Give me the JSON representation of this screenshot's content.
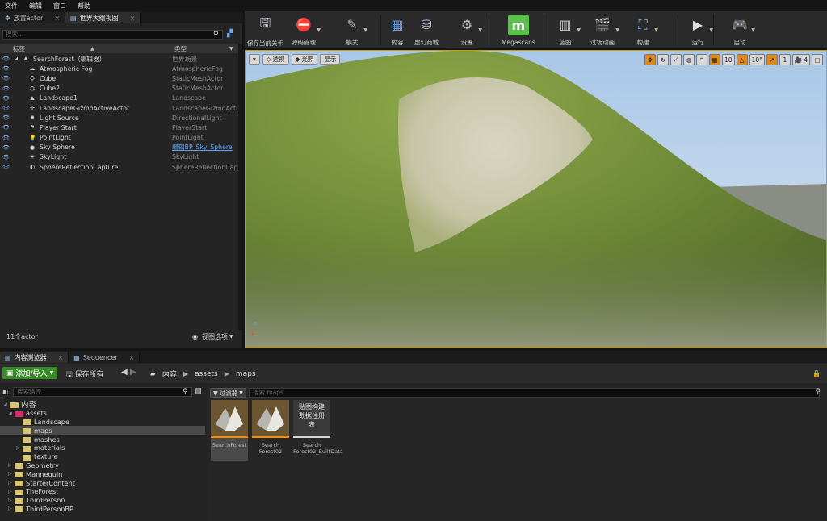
{
  "menubar": [
    "文件",
    "编辑",
    "窗口",
    "帮助"
  ],
  "left_tabs": [
    {
      "label": "放置actor",
      "active": false
    },
    {
      "label": "世界大纲视图",
      "active": true
    }
  ],
  "outliner": {
    "search_placeholder": "搜索...",
    "col_label": "标签",
    "col_type": "类型",
    "rows": [
      {
        "name": "SearchForest（编辑器）",
        "type": "世界场景",
        "icon": "world-icon",
        "indent": 0
      },
      {
        "name": "Atmospheric Fog",
        "type": "AtmosphericFog",
        "icon": "fog-icon",
        "indent": 1
      },
      {
        "name": "Cube",
        "type": "StaticMeshActor",
        "icon": "cube-icon",
        "indent": 1
      },
      {
        "name": "Cube2",
        "type": "StaticMeshActor",
        "icon": "cube-icon",
        "indent": 1
      },
      {
        "name": "Landscape1",
        "type": "Landscape",
        "icon": "landscape-icon",
        "indent": 1
      },
      {
        "name": "LandscapeGizmoActiveActor",
        "type": "LandscapeGizmoActive",
        "icon": "gizmo-icon",
        "indent": 1
      },
      {
        "name": "Light Source",
        "type": "DirectionalLight",
        "icon": "directional-light-icon",
        "indent": 1
      },
      {
        "name": "Player Start",
        "type": "PlayerStart",
        "icon": "player-start-icon",
        "indent": 1
      },
      {
        "name": "PointLight",
        "type": "PointLight",
        "icon": "point-light-icon",
        "indent": 1
      },
      {
        "name": "Sky Sphere",
        "type": "编辑BP_Sky_Sphere",
        "icon": "sphere-icon",
        "indent": 1,
        "link": true
      },
      {
        "name": "SkyLight",
        "type": "SkyLight",
        "icon": "sky-light-icon",
        "indent": 1
      },
      {
        "name": "SphereReflectionCapture",
        "type": "SphereReflectionCapture",
        "icon": "reflection-icon",
        "indent": 1
      }
    ],
    "actor_count": "11个actor",
    "view_options": "视图选项"
  },
  "toolbar": [
    {
      "label": "保存当前关卡",
      "icon": "save-icon",
      "color": "#cfd6e0"
    },
    {
      "label": "源码管理",
      "icon": "source-control-icon",
      "color": "#b8c0cc"
    },
    {
      "label": "模式",
      "icon": "modes-icon",
      "color": "#c0c0c0"
    },
    {
      "label": "内容",
      "icon": "content-icon",
      "color": "#6aa0e0"
    },
    {
      "label": "虚幻商城",
      "icon": "marketplace-icon",
      "color": "#c0d0f0"
    },
    {
      "label": "设置",
      "icon": "settings-icon",
      "color": "#c0c0c0"
    },
    {
      "label": "Megascans",
      "icon": "megascans-icon",
      "color": "#5ac24a"
    },
    {
      "label": "蓝图",
      "icon": "blueprint-icon",
      "color": "#c8c8c8"
    },
    {
      "label": "过场动画",
      "icon": "cinematics-icon",
      "color": "#c8c8c8"
    },
    {
      "label": "构建",
      "icon": "build-icon",
      "color": "#7aa8e8"
    },
    {
      "label": "运行",
      "icon": "play-icon",
      "color": "#e0e0e0"
    },
    {
      "label": "启动",
      "icon": "launch-icon",
      "color": "#c8c8c8"
    }
  ],
  "viewport": {
    "perspective": "透视",
    "lit": "光照",
    "show": "显示",
    "grid_snap": "10",
    "rot_snap": "10°",
    "scale_snap": "1",
    "camera_speed": "4"
  },
  "bottom_tabs": [
    {
      "label": "内容浏览器",
      "active": true
    },
    {
      "label": "Sequencer",
      "active": false
    }
  ],
  "content_browser": {
    "add_import": "添加/导入",
    "save_all": "保存所有",
    "breadcrumbs": [
      "内容",
      "assets",
      "maps"
    ],
    "tree_search_placeholder": "搜索路径",
    "filter_label": "过滤器",
    "asset_search_placeholder": "搜索 maps",
    "tree": [
      {
        "label": "内容",
        "indent": 0,
        "expanded": true,
        "color": "#d8c478"
      },
      {
        "label": "assets",
        "indent": 1,
        "expanded": true,
        "color": "#d0306a",
        "selected": true
      },
      {
        "label": "Landscape",
        "indent": 2,
        "color": "#d8c478"
      },
      {
        "label": "maps",
        "indent": 2,
        "color": "#d8c478",
        "selected": true
      },
      {
        "label": "mashes",
        "indent": 2,
        "color": "#d8c478"
      },
      {
        "label": "materials",
        "indent": 2,
        "collapsed": true,
        "color": "#d8c478"
      },
      {
        "label": "texture",
        "indent": 2,
        "color": "#d8c478"
      },
      {
        "label": "Geometry",
        "indent": 1,
        "collapsed": true,
        "color": "#d8c478"
      },
      {
        "label": "Mannequin",
        "indent": 1,
        "collapsed": true,
        "color": "#d8c478"
      },
      {
        "label": "StarterContent",
        "indent": 1,
        "collapsed": true,
        "color": "#d8c478"
      },
      {
        "label": "TheForest",
        "indent": 1,
        "collapsed": true,
        "color": "#d8c478"
      },
      {
        "label": "ThirdPerson",
        "indent": 1,
        "collapsed": true,
        "color": "#d8c478"
      },
      {
        "label": "ThirdPersonBP",
        "indent": 1,
        "collapsed": true,
        "color": "#d8c478"
      }
    ],
    "assets": [
      {
        "label": "SearchForest",
        "kind": "map",
        "selected": true
      },
      {
        "label": "Search Forest02",
        "kind": "map",
        "selected": false
      },
      {
        "label": "Search Forest02_BuiltData",
        "kind": "registry",
        "thumb_text": "贴图构建数据注册表",
        "selected": false
      }
    ]
  }
}
